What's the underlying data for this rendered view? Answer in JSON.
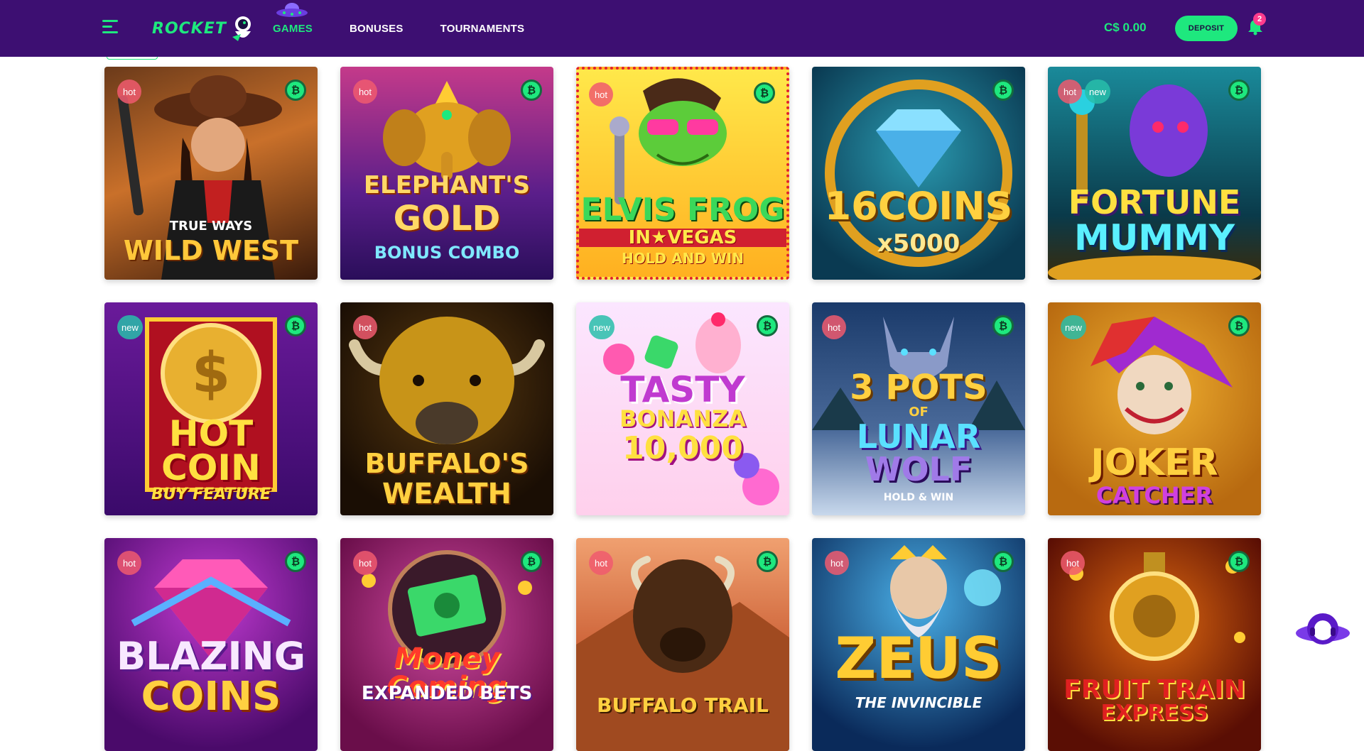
{
  "header": {
    "logo_text": "ROCKET",
    "nav": [
      {
        "label": "GAMES",
        "active": true
      },
      {
        "label": "BONUSES",
        "active": false
      },
      {
        "label": "TOURNAMENTS",
        "active": false
      }
    ],
    "balance": "C$ 0.00",
    "deposit_label": "DEPOSIT",
    "notification_count": "2"
  },
  "badge_labels": {
    "hot": "hot",
    "new": "new"
  },
  "crypto_symbol": "₿",
  "colors": {
    "header_bg": "#3d0f72",
    "accent_green": "#1ee87e",
    "hot_badge": "#f05a6e",
    "new_badge": "#28beaa"
  },
  "games": [
    {
      "lines": [
        "TRUE WAYS",
        "WILD WEST"
      ],
      "badges": [
        "hot"
      ],
      "crypto": true
    },
    {
      "lines": [
        "ELEPHANT'S",
        "GOLD",
        "BONUS COMBO"
      ],
      "badges": [
        "hot"
      ],
      "crypto": true
    },
    {
      "lines": [
        "ELVIS FROG",
        "IN★VEGAS",
        "HOLD AND WIN"
      ],
      "badges": [
        "hot"
      ],
      "crypto": true
    },
    {
      "lines": [
        "16COINS",
        "x5000"
      ],
      "badges": [],
      "crypto": true
    },
    {
      "lines": [
        "FORTUNE",
        "MUMMY"
      ],
      "badges": [
        "hot",
        "new"
      ],
      "crypto": true
    },
    {
      "lines": [
        "HOT",
        "COIN",
        "BUY FEATURE"
      ],
      "badges": [
        "new"
      ],
      "crypto": true
    },
    {
      "lines": [
        "BUFFALO'S",
        "WEALTH"
      ],
      "badges": [
        "hot"
      ],
      "crypto": false
    },
    {
      "lines": [
        "TASTY",
        "BONANZA",
        "10,000"
      ],
      "badges": [
        "new"
      ],
      "crypto": true
    },
    {
      "lines": [
        "3 POTS",
        "OF",
        "LUNAR",
        "WOLF",
        "HOLD & WIN"
      ],
      "badges": [
        "hot"
      ],
      "crypto": true
    },
    {
      "lines": [
        "JOKER",
        "CATCHER"
      ],
      "badges": [
        "new"
      ],
      "crypto": true
    },
    {
      "lines": [
        "BLAZING",
        "COINS"
      ],
      "badges": [
        "hot"
      ],
      "crypto": true
    },
    {
      "lines": [
        "Money Coming",
        "EXPANDED BETS"
      ],
      "badges": [
        "hot"
      ],
      "crypto": true
    },
    {
      "lines": [
        "BUFFALO TRAIL"
      ],
      "badges": [
        "hot"
      ],
      "crypto": true
    },
    {
      "lines": [
        "ZEUS",
        "THE INVINCIBLE"
      ],
      "badges": [
        "hot"
      ],
      "crypto": true
    },
    {
      "lines": [
        "FRUIT TRAIN",
        "EXPRESS"
      ],
      "badges": [
        "hot"
      ],
      "crypto": true
    }
  ]
}
